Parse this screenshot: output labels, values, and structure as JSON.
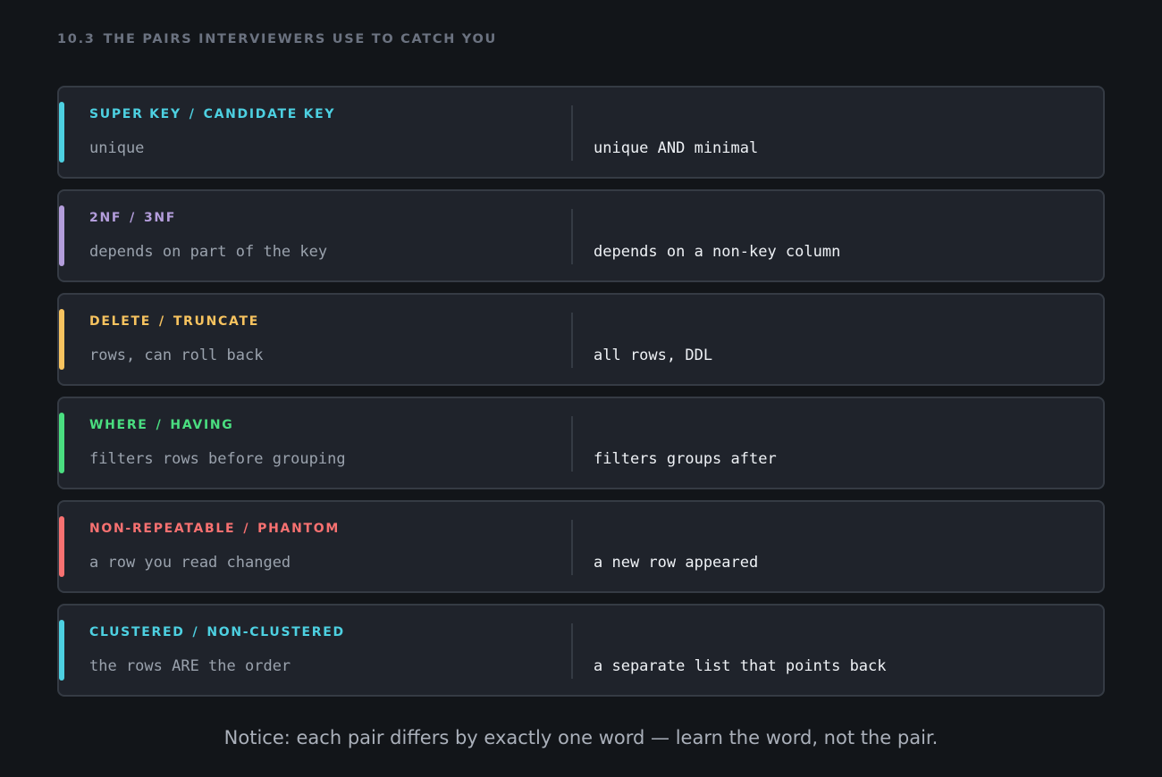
{
  "section": {
    "number": "10.3",
    "title": "THE PAIRS INTERVIEWERS USE TO CATCH YOU"
  },
  "pairs": [
    {
      "left_term": "SUPER KEY",
      "separator": "/",
      "right_term": "CANDIDATE KEY",
      "left_desc": "unique",
      "right_desc": "unique AND minimal",
      "color": "#4dd0e1"
    },
    {
      "left_term": "2NF",
      "separator": "/",
      "right_term": "3NF",
      "left_desc": "depends on part of the key",
      "right_desc": "depends on a non-key column",
      "color": "#b39ddb"
    },
    {
      "left_term": "DELETE",
      "separator": "/",
      "right_term": "TRUNCATE",
      "left_desc": "rows, can roll back",
      "right_desc": "all rows, DDL",
      "color": "#f7c35f"
    },
    {
      "left_term": "WHERE",
      "separator": "/",
      "right_term": "HAVING",
      "left_desc": "filters rows before grouping",
      "right_desc": "filters groups after",
      "color": "#4ade80"
    },
    {
      "left_term": "NON-REPEATABLE",
      "separator": "/",
      "right_term": "PHANTOM",
      "left_desc": "a row you read changed",
      "right_desc": "a new row appeared",
      "color": "#f87171"
    },
    {
      "left_term": "CLUSTERED",
      "separator": "/",
      "right_term": "NON-CLUSTERED",
      "left_desc": "the rows ARE the order",
      "right_desc": "a separate list that points back",
      "color": "#4dd0e1"
    }
  ],
  "footer": {
    "note": "Notice: each pair differs by exactly one word — learn the word, not the pair."
  }
}
